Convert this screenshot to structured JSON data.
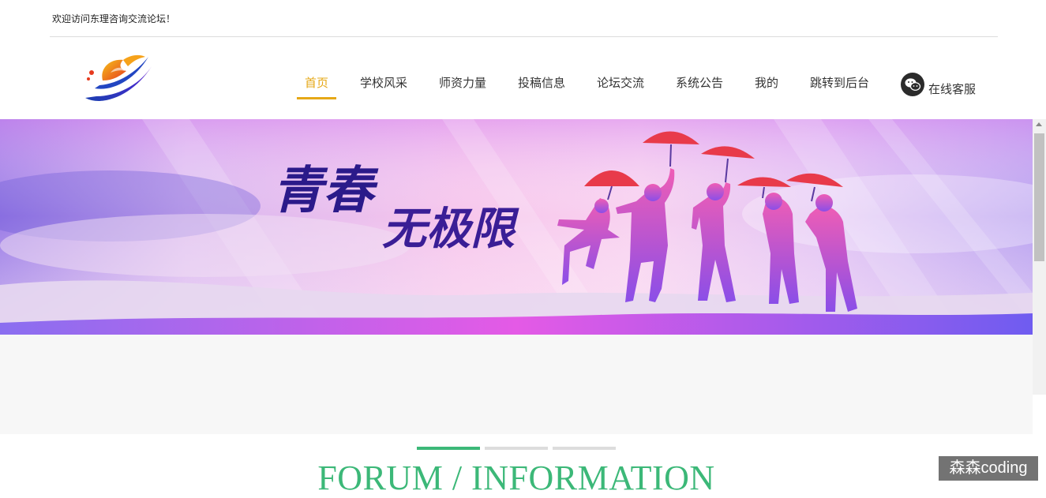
{
  "header": {
    "welcome_text": "欢迎访问东理咨询交流论坛！"
  },
  "nav": {
    "items": [
      {
        "label": "首页",
        "active": true
      },
      {
        "label": "学校风采",
        "active": false
      },
      {
        "label": "师资力量",
        "active": false
      },
      {
        "label": "投稿信息",
        "active": false
      },
      {
        "label": "论坛交流",
        "active": false
      },
      {
        "label": "系统公告",
        "active": false
      },
      {
        "label": "我的",
        "active": false
      },
      {
        "label": "跳转到后台",
        "active": false
      }
    ],
    "service_label": "在线客服",
    "service_icon": "wechat-icon"
  },
  "banner": {
    "title_line1": "青春",
    "title_line2": "无极限"
  },
  "section": {
    "heading": "FORUM / INFORMATION"
  },
  "watermark": "森森coding",
  "colors": {
    "accent": "#e6a817",
    "heading_green": "#3cb878",
    "bar_green": "#3cb878",
    "bar_gray": "#dddddd"
  }
}
